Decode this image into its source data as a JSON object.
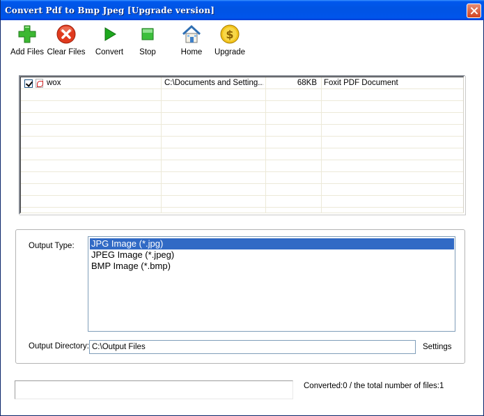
{
  "window": {
    "title": "Convert Pdf to Bmp Jpeg [Upgrade version]"
  },
  "toolbar": {
    "add_files": "Add Files",
    "clear_files": "Clear Files",
    "convert": "Convert",
    "stop": "Stop",
    "home": "Home",
    "upgrade": "Upgrade"
  },
  "files": [
    {
      "checked": true,
      "name": "wox",
      "path": "C:\\Documents and Setting...",
      "size": "68KB",
      "type": "Foxit PDF Document"
    }
  ],
  "output": {
    "type_label": "Output Type:",
    "types": [
      "JPG Image (*.jpg)",
      "JPEG Image (*.jpeg)",
      "BMP Image (*.bmp)"
    ],
    "selected_type": "JPG Image (*.jpg)",
    "dir_label": "Output Directory:",
    "dir_value": "C:\\Output Files",
    "settings": "Settings"
  },
  "status": {
    "progress": 0,
    "text": "Converted:0  /  the total number of files:1"
  },
  "colors": {
    "titlebar": "#0054e3",
    "selection": "#316ac5",
    "add_icon": "#3cb832",
    "clear_icon": "#e03a1e",
    "convert_icon": "#1ea81e",
    "stop_icon": "#3cbf3c",
    "upgrade_icon": "#f2c21b"
  },
  "icons": {
    "add_files": "plus-icon",
    "clear_files": "x-circle-icon",
    "convert": "play-icon",
    "stop": "stop-square-icon",
    "home": "house-icon",
    "upgrade": "dollar-coin-icon"
  }
}
